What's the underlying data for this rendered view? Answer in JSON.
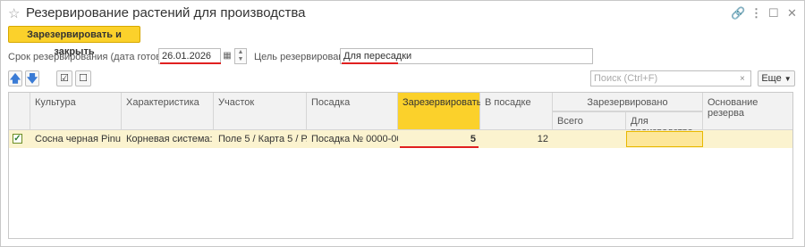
{
  "window": {
    "title": "Резервирование растений для производства",
    "icons": [
      "star-icon",
      "link-icon",
      "more-icon",
      "maximize-icon",
      "close-icon"
    ]
  },
  "toolbar": {
    "reserve_close_label": "Зарезервировать и закрыть",
    "more_label": "Еще",
    "search_placeholder": "Поиск (Ctrl+F)"
  },
  "form": {
    "date_label": "Срок резервирования (дата готовности):",
    "date_value": "26.01.2026",
    "purpose_label": "Цель резервирования:",
    "purpose_value": "Для пересадки"
  },
  "grid": {
    "headers": {
      "culture": "Культура",
      "characteristic": "Характеристика",
      "section": "Участок",
      "planting": "Посадка",
      "reserve": "Зарезервировать",
      "in_planting": "В посадке",
      "reserved": "Зарезервировано",
      "total": "Всего",
      "for_production": "Для производства",
      "reason": "Основание резерва"
    },
    "rows": [
      {
        "checked": true,
        "culture": "Сосна черная Pinu...",
        "characteristic": "Корневая система: ...",
        "section": "Поле 5 / Карта 5 / Р...",
        "planting": "Посадка № 0000-00...",
        "reserve": "5",
        "in_planting": "12",
        "total": "",
        "for_production": "",
        "reason": ""
      }
    ]
  },
  "colors": {
    "accent": "#fbd12b",
    "highlight_row": "#fbf3cf",
    "error_underline": "#e02020"
  }
}
